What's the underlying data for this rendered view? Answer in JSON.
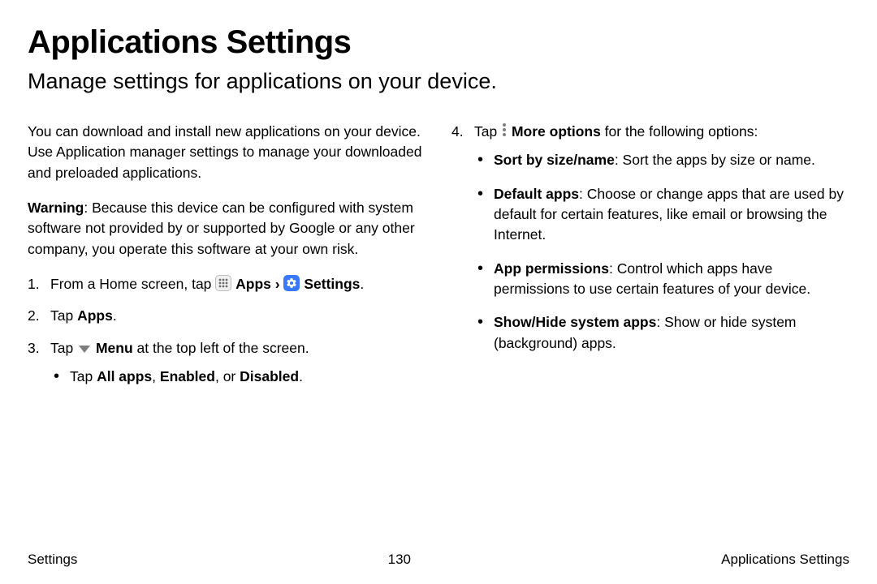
{
  "title": "Applications Settings",
  "subtitle": "Manage settings for applications on your device.",
  "intro": "You can download and install new applications on your device. Use Application manager settings to manage your downloaded and preloaded applications.",
  "warning_label": "Warning",
  "warning_body": ": Because this device can be configured with system software not provided by or supported by Google or any other company, you operate this software at your own risk.",
  "step1_prefix": "From a Home screen, tap ",
  "apps_label": "Apps",
  "chevron": "›",
  "settings_label": "Settings",
  "period": ".",
  "step2_prefix": "Tap ",
  "step2_bold": "Apps",
  "step3_prefix": "Tap ",
  "step3_bold": "Menu",
  "step3_suffix": " at the top left of the screen.",
  "step3_bullet_prefix": "Tap ",
  "step3_bullet_b1": "All apps",
  "step3_bullet_mid1": ", ",
  "step3_bullet_b2": "Enabled",
  "step3_bullet_mid2": ", or ",
  "step3_bullet_b3": "Disabled",
  "step4_prefix": "Tap ",
  "step4_bold": "More options",
  "step4_suffix": " for the following options:",
  "opt1_bold": "Sort by size/name",
  "opt1_body": ": Sort the apps by size or name.",
  "opt2_bold": "Default apps",
  "opt2_body": ": Choose or change apps that are used by default for certain features, like email or browsing the Internet.",
  "opt3_bold": "App permissions",
  "opt3_body": ": Control which apps have permissions to use certain features of your device.",
  "opt4_bold": "Show/Hide system apps",
  "opt4_body": ": Show or hide system (background) apps.",
  "footer_left": "Settings",
  "footer_page": "130",
  "footer_right": "Applications Settings"
}
